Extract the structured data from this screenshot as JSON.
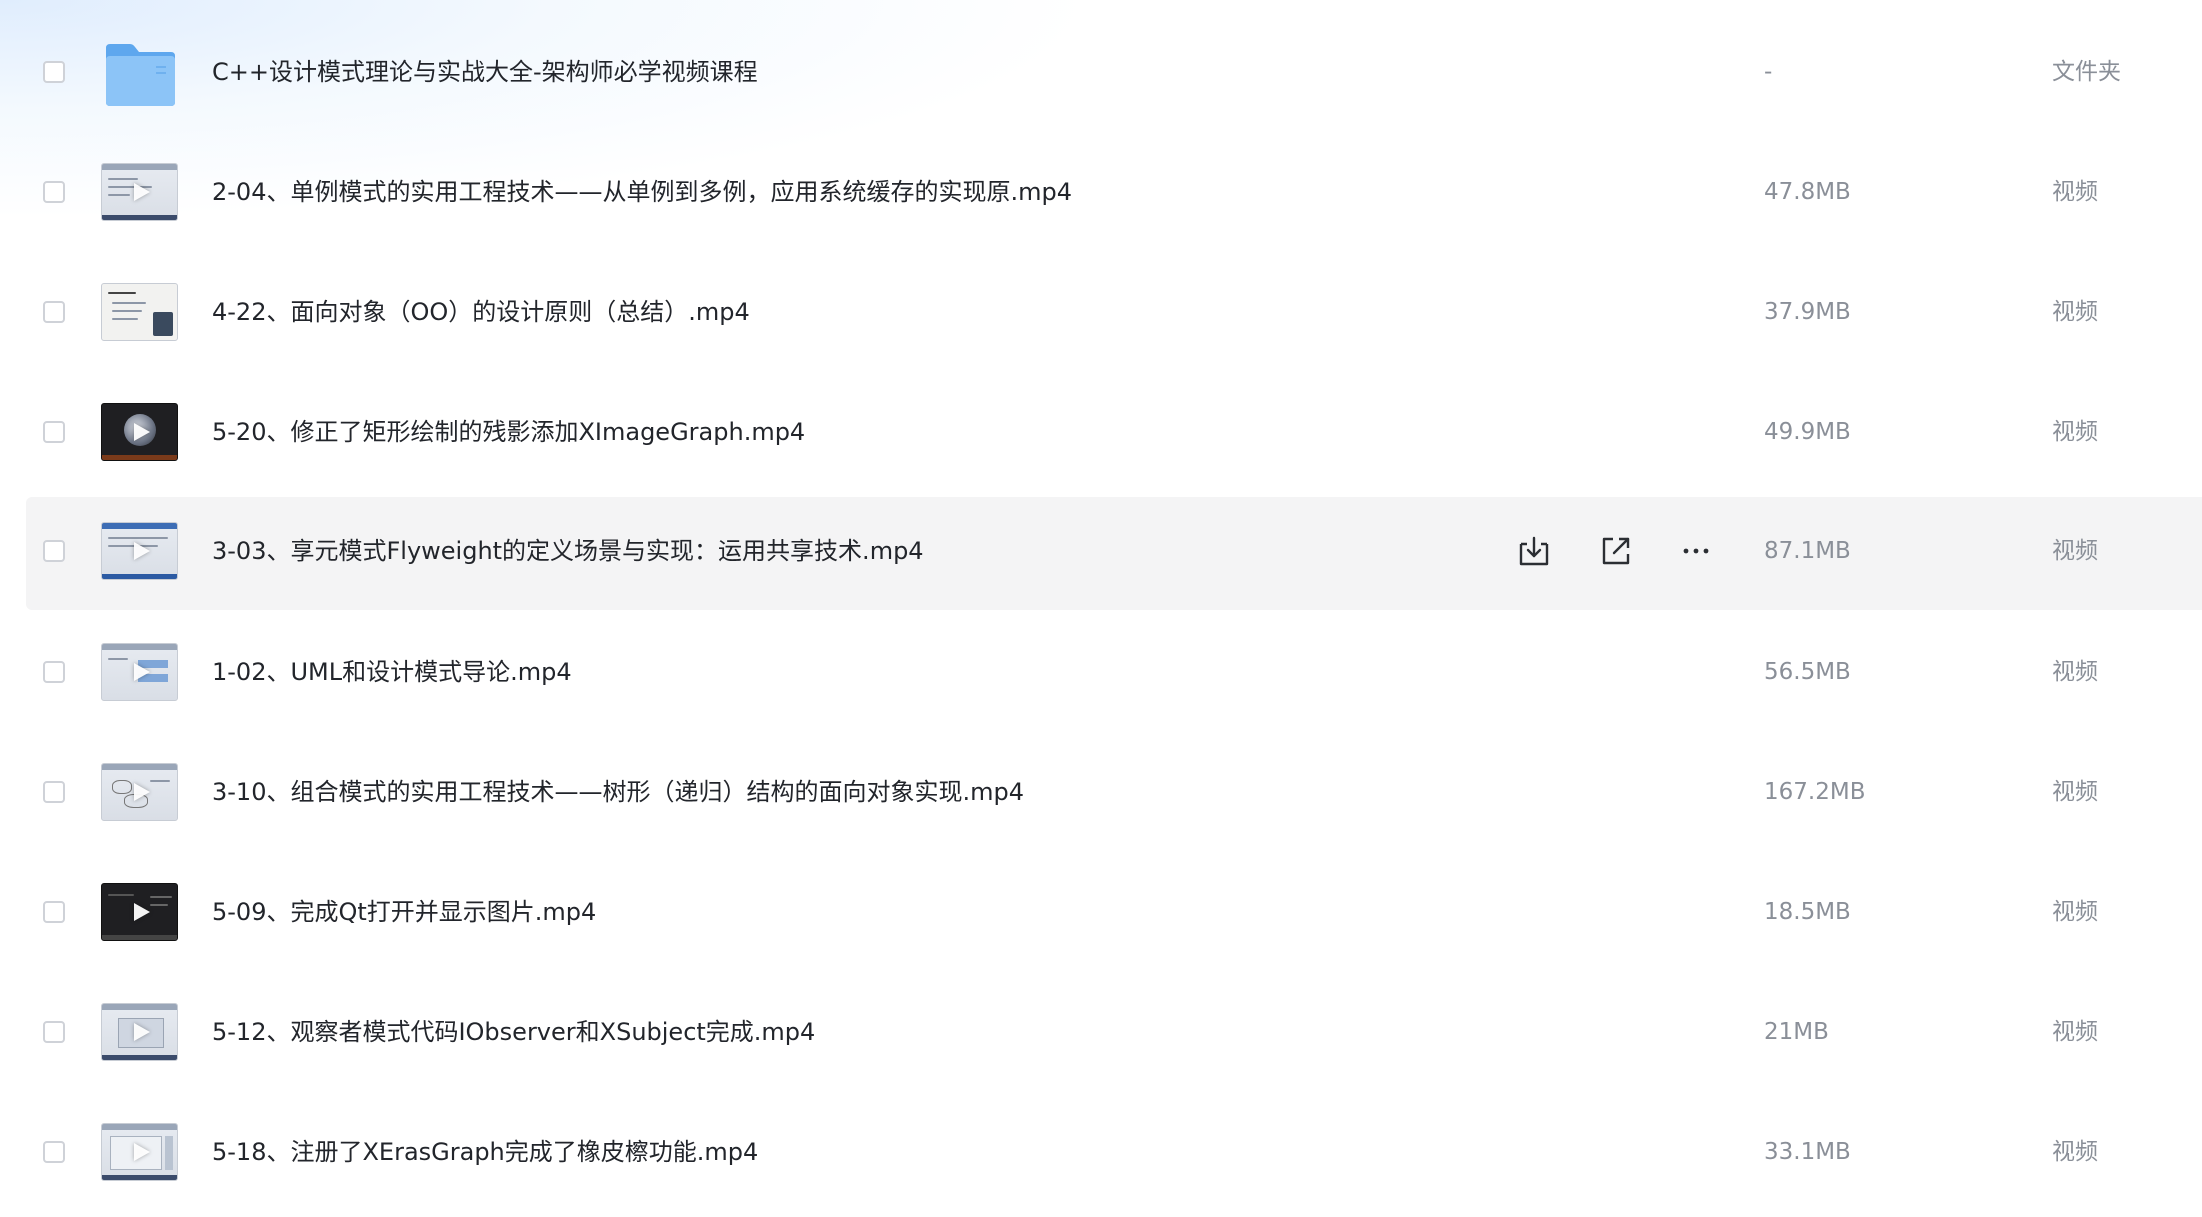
{
  "files": [
    {
      "name": "C++设计模式理论与实战大全-架构师必学视频课程",
      "size": "-",
      "type": "文件夹",
      "kind": "folder",
      "icon": "folder-icon"
    },
    {
      "name": "2-04、单例模式的实用工程技术——从单例到多例，应用系统缓存的实现原.mp4",
      "size": "47.8MB",
      "type": "视频",
      "kind": "video",
      "thumb": "light"
    },
    {
      "name": "4-22、面向对象（OO）的设计原则（总结）.mp4",
      "size": "37.9MB",
      "type": "视频",
      "kind": "video",
      "thumb": "light"
    },
    {
      "name": "5-20、修正了矩形绘制的残影添加XImageGraph.mp4",
      "size": "49.9MB",
      "type": "视频",
      "kind": "video",
      "thumb": "dark"
    },
    {
      "name": "3-03、享元模式Flyweight的定义场景与实现：运用共享技术.mp4",
      "size": "87.1MB",
      "type": "视频",
      "kind": "video",
      "thumb": "light",
      "hovered": true
    },
    {
      "name": "1-02、UML和设计模式导论.mp4",
      "size": "56.5MB",
      "type": "视频",
      "kind": "video",
      "thumb": "light"
    },
    {
      "name": "3-10、组合模式的实用工程技术——树形（递归）结构的面向对象实现.mp4",
      "size": "167.2MB",
      "type": "视频",
      "kind": "video",
      "thumb": "light"
    },
    {
      "name": "5-09、完成Qt打开并显示图片.mp4",
      "size": "18.5MB",
      "type": "视频",
      "kind": "video",
      "thumb": "dark"
    },
    {
      "name": "5-12、观察者模式代码IObserver和XSubject完成.mp4",
      "size": "21MB",
      "type": "视频",
      "kind": "video",
      "thumb": "light"
    },
    {
      "name": "5-18、注册了XErasGraph完成了橡皮檫功能.mp4",
      "size": "33.1MB",
      "type": "视频",
      "kind": "video",
      "thumb": "light"
    }
  ],
  "row_actions": [
    {
      "icon": "download-icon"
    },
    {
      "icon": "share-icon"
    },
    {
      "icon": "more-icon"
    }
  ],
  "colors": {
    "folder_blue": "#5aa8f2",
    "text_primary": "#22252b",
    "text_secondary": "#8a8f98",
    "hover_bg": "#f4f4f5"
  }
}
